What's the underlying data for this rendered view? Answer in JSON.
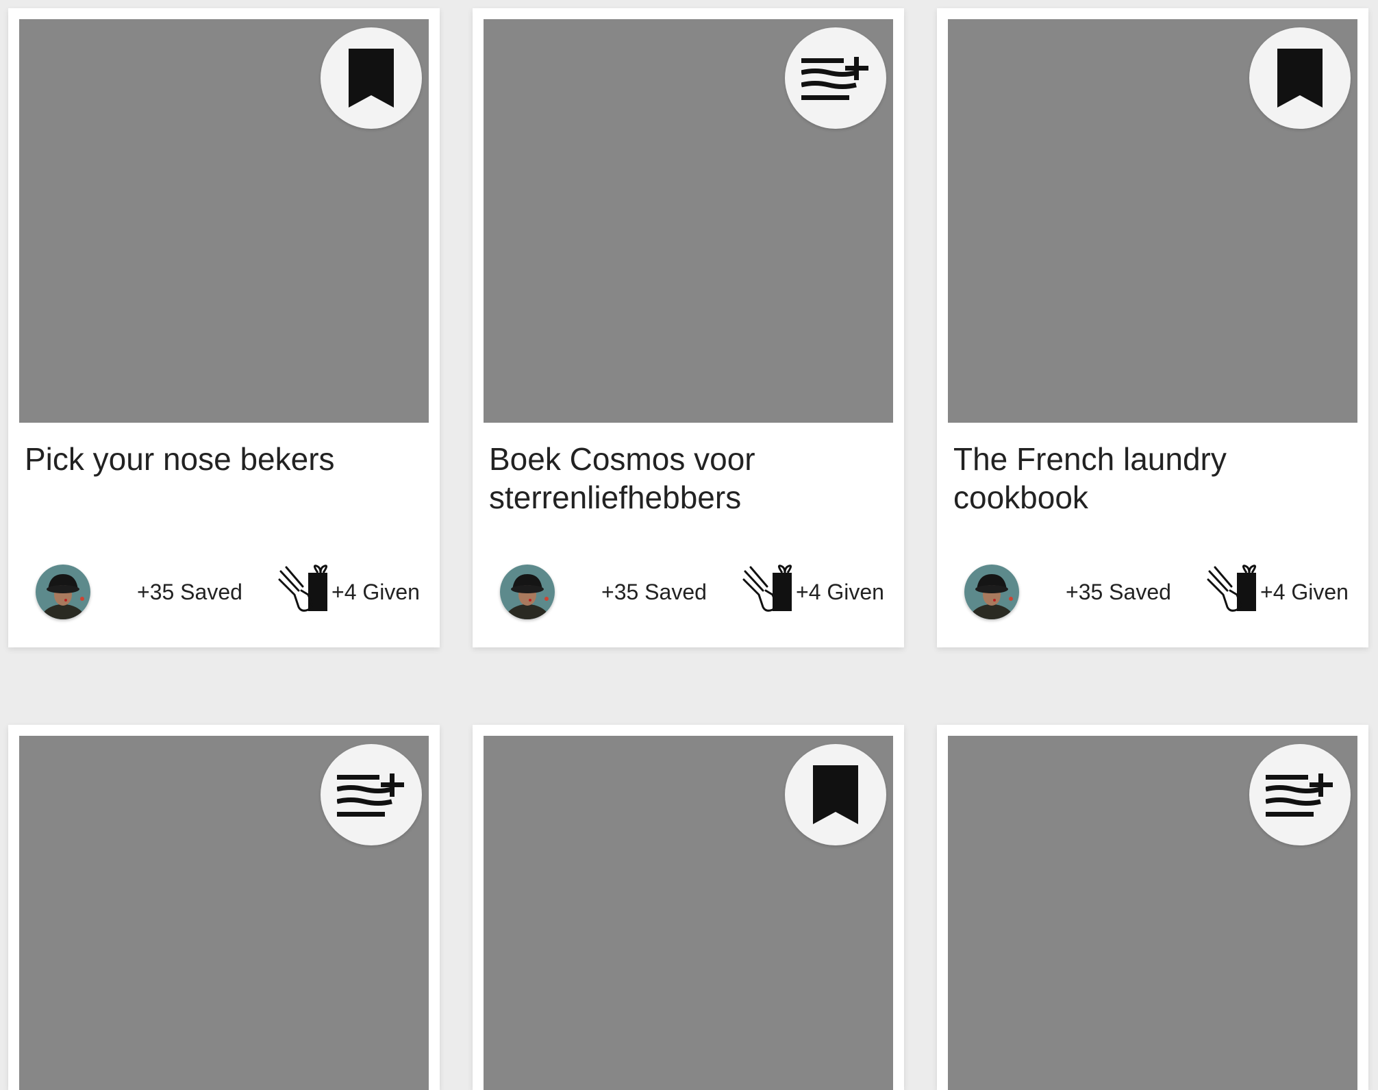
{
  "colors": {
    "page_background": "#ececec",
    "card_background": "#ffffff",
    "image_placeholder": "#878787",
    "action_button_bg": "#f3f3f3",
    "icon_color": "#111111"
  },
  "cards": [
    {
      "title": "Pick your nose bekers",
      "action_icon": "bookmark-icon",
      "saved": "+35 Saved",
      "given": "+4 Given"
    },
    {
      "title": "Boek Cosmos voor sterrenliefhebbers",
      "action_icon": "playlist-add-icon",
      "saved": "+35 Saved",
      "given": "+4 Given"
    },
    {
      "title": "The French laundry cookbook",
      "action_icon": "bookmark-icon",
      "saved": "+35 Saved",
      "given": "+4 Given"
    },
    {
      "title": "",
      "action_icon": "playlist-add-icon",
      "saved": "",
      "given": ""
    },
    {
      "title": "",
      "action_icon": "bookmark-icon",
      "saved": "",
      "given": ""
    },
    {
      "title": "",
      "action_icon": "playlist-add-icon",
      "saved": "",
      "given": ""
    }
  ]
}
